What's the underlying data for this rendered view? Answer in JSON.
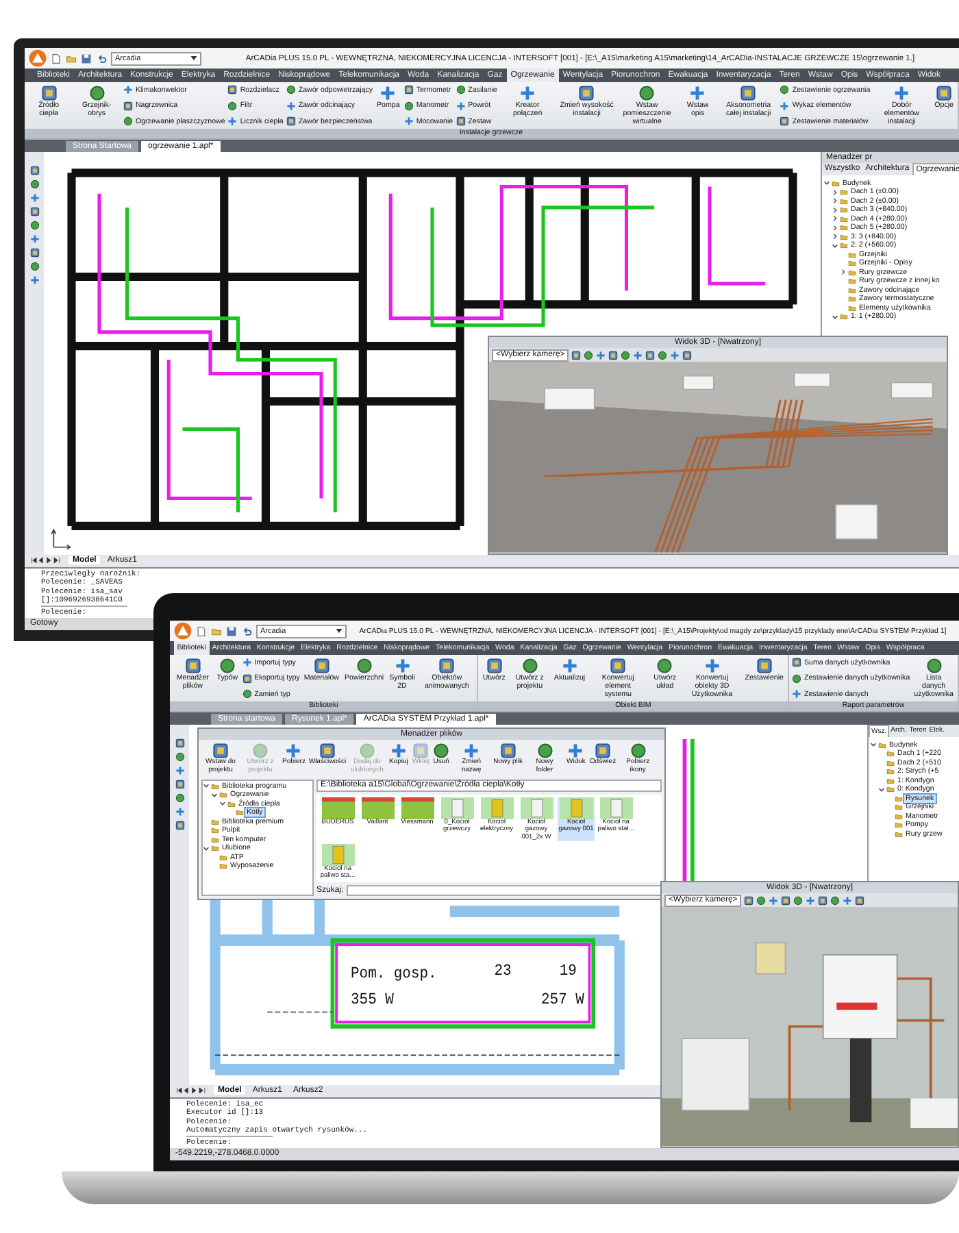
{
  "monitor": {
    "title": "ArCADia PLUS 15.0 PL - WEWNĘTRZNA, NIEKOMERCYJNA LICENCJA - INTERSOFT [001] - [E:\\_A15\\marketing A15\\marketing\\14_ArCADia-INSTALACJE GRZEWCZE 15\\ogrzewanie 1.]",
    "layer_dropdown": "Arcadia",
    "menu_tabs": [
      {
        "label": "Biblioteki",
        "selected": false
      },
      {
        "label": "Architektura",
        "selected": false
      },
      {
        "label": "Konstrukcje",
        "selected": false
      },
      {
        "label": "Elektryka",
        "selected": false
      },
      {
        "label": "Rozdzielnice",
        "selected": false
      },
      {
        "label": "Niskoprądowe",
        "selected": false
      },
      {
        "label": "Telekomunikacja",
        "selected": false
      },
      {
        "label": "Woda",
        "selected": false
      },
      {
        "label": "Kanalizacja",
        "selected": false
      },
      {
        "label": "Gaz",
        "selected": false
      },
      {
        "label": "Ogrzewanie",
        "selected": true
      },
      {
        "label": "Wentylacja",
        "selected": false
      },
      {
        "label": "Piorunochron",
        "selected": false
      },
      {
        "label": "Ewakuacja",
        "selected": false
      },
      {
        "label": "Inwentaryzacja",
        "selected": false
      },
      {
        "label": "Teren",
        "selected": false
      },
      {
        "label": "Wstaw",
        "selected": false
      },
      {
        "label": "Opis",
        "selected": false
      },
      {
        "label": "Współpraca",
        "selected": false
      },
      {
        "label": "Widok",
        "selected": false
      }
    ],
    "ribbon": [
      {
        "label": "Instalacje grzewcze",
        "columns": [
          {
            "kind": "large",
            "label": "Źródło ciepła"
          },
          {
            "kind": "large",
            "label": "Grzejnik-obrys"
          },
          {
            "kind": "stack",
            "items": [
              "Klimakonwektor",
              "Nagrzewnica",
              "Ogrzewanie płaszczyznowe"
            ]
          },
          {
            "kind": "stack",
            "items": [
              "Rozdzielacz",
              "Filtr",
              "Licznik ciepła"
            ]
          },
          {
            "kind": "stack",
            "items": [
              "Zawór odpowietrzający",
              "Zawór odcinający",
              "Zawór bezpieczeństwa"
            ]
          },
          {
            "kind": "large",
            "label": "Pompa"
          },
          {
            "kind": "stack",
            "items": [
              "Termometr",
              "Manometr",
              "Mocowanie"
            ]
          },
          {
            "kind": "stack",
            "items": [
              "Zasilanie",
              "Powrót",
              "Zestaw"
            ]
          },
          {
            "kind": "large",
            "label": "Kreator połączeń"
          },
          {
            "kind": "large",
            "label": "Zmień wysokość instalacji"
          },
          {
            "kind": "large",
            "label": "Wstaw pomieszczenie wirtualne"
          },
          {
            "kind": "large",
            "label": "Wstaw opis"
          },
          {
            "kind": "large",
            "label": "Aksonometria całej instalacji"
          },
          {
            "kind": "stack",
            "items": [
              "Zestawienie ogrzewania",
              "Wykaz elementów",
              "Zestawienie materiałów"
            ]
          },
          {
            "kind": "large",
            "label": "Dobór elementów instalacji"
          },
          {
            "kind": "large",
            "label": "Opcje"
          }
        ]
      }
    ],
    "doc_tabs": [
      {
        "label": "Strona Startowa",
        "selected": false
      },
      {
        "label": "ogrzewanie 1.apl*",
        "selected": true
      }
    ],
    "panel": {
      "title": "Menadżer pr",
      "tabs": [
        {
          "label": "Wszystko",
          "selected": false
        },
        {
          "label": "Architektura",
          "selected": false
        },
        {
          "label": "Ogrzewanie",
          "selected": true
        }
      ],
      "tree": [
        {
          "label": "Budynek",
          "expanded": true,
          "selected": false,
          "children": [
            {
              "label": "Dach 1 (±0.00)",
              "expanded": false,
              "selected": false
            },
            {
              "label": "Dach 2 (±0.00)",
              "expanded": false,
              "selected": false
            },
            {
              "label": "Dach 3 (+840.00)",
              "expanded": false,
              "selected": false
            },
            {
              "label": "Dach 4 (+280.00)",
              "expanded": false,
              "selected": false
            },
            {
              "label": "Dach 5 (+280.00)",
              "expanded": false,
              "selected": false
            },
            {
              "label": "3: 3 (+840.00)",
              "expanded": false,
              "selected": false
            },
            {
              "label": "2: 2 (+560.00)",
              "expanded": true,
              "selected": false,
              "children": [
                {
                  "label": "Grzejniki",
                  "selected": false
                },
                {
                  "label": "Grzejniki - Opisy",
                  "selected": false
                },
                {
                  "label": "Rury grzewcze",
                  "expanded": false,
                  "selected": false
                },
                {
                  "label": "Rury grzewcze z innej ko",
                  "selected": false
                },
                {
                  "label": "Zawory odcinające",
                  "selected": false
                },
                {
                  "label": "Zawory termostatyczne",
                  "selected": false
                },
                {
                  "label": "Elementy użytkownika",
                  "selected": false
                }
              ]
            },
            {
              "label": "1: 1 (+280.00)",
              "expanded": true,
              "selected": false
            }
          ]
        }
      ]
    },
    "view3d": {
      "title": "Widok 3D - [Nwatrzony]",
      "camera": "<Wybierz kamerę>"
    },
    "sheet_tabs": [
      {
        "label": "Model",
        "selected": true
      },
      {
        "label": "Arkusz1",
        "selected": false
      }
    ],
    "command": {
      "history": [
        "Przeciwległy narożnik:",
        "Polecenie: _SAVEAS",
        "Polecenie: isa_sav",
        "[]:1096926938641C0"
      ],
      "prompt": "Polecenie:"
    },
    "status": "Gotowy"
  },
  "laptop": {
    "title": "ArCADia PLUS 15.0 PL - WEWNĘTRZNA, NIEKOMERCYJNA LICENCJA - INTERSOFT [001] - [E:\\_A15\\Projekty\\od magdy ze\\przyklady\\15 przyklady ene\\ArCADia SYSTEM Przykład 1]",
    "layer_dropdown": "Arcadia",
    "menu_tabs": [
      {
        "label": "Biblioteki",
        "selected": true
      },
      {
        "label": "Architektura",
        "selected": false
      },
      {
        "label": "Konstrukcje",
        "selected": false
      },
      {
        "label": "Elektryka",
        "selected": false
      },
      {
        "label": "Rozdzielnice",
        "selected": false
      },
      {
        "label": "Niskoprądowe",
        "selected": false
      },
      {
        "label": "Telekomunikacja",
        "selected": false
      },
      {
        "label": "Woda",
        "selected": false
      },
      {
        "label": "Kanalizacja",
        "selected": false
      },
      {
        "label": "Gaz",
        "selected": false
      },
      {
        "label": "Ogrzewanie",
        "selected": false
      },
      {
        "label": "Wentylacja",
        "selected": false
      },
      {
        "label": "Piorunochron",
        "selected": false
      },
      {
        "label": "Ewakuacja",
        "selected": false
      },
      {
        "label": "Inwentaryzacja",
        "selected": false
      },
      {
        "label": "Teren",
        "selected": false
      },
      {
        "label": "Wstaw",
        "selected": false
      },
      {
        "label": "Opis",
        "selected": false
      },
      {
        "label": "Współpraca",
        "selected": false
      }
    ],
    "ribbon": [
      {
        "label": "Biblioteki",
        "columns": [
          {
            "kind": "large",
            "label": "Menadżer plików"
          },
          {
            "kind": "large",
            "label": "Typów"
          },
          {
            "kind": "stack",
            "items": [
              "Importuj typy",
              "Eksportuj typy",
              "Zamień typ"
            ]
          },
          {
            "kind": "large",
            "label": "Materiałów"
          },
          {
            "kind": "large",
            "label": "Powierzchni"
          },
          {
            "kind": "large",
            "label": "Symboli 2D"
          },
          {
            "kind": "large",
            "label": "Obiektów animowanych"
          }
        ]
      },
      {
        "label": "Obiekt BIM",
        "columns": [
          {
            "kind": "large",
            "label": "Utwórz"
          },
          {
            "kind": "large",
            "label": "Utwórz z projektu"
          },
          {
            "kind": "large",
            "label": "Aktualizuj"
          },
          {
            "kind": "large",
            "label": "Konwertuj element systemu"
          },
          {
            "kind": "large",
            "label": "Utwórz układ"
          },
          {
            "kind": "large",
            "label": "Konwertuj obiekty 3D Użytkownika"
          },
          {
            "kind": "large",
            "label": "Zestawienie"
          }
        ]
      },
      {
        "label": "Raport parametrów",
        "columns": [
          {
            "kind": "stack",
            "items": [
              "Suma danych użytkownika",
              "Zestawienie danych użytkownika",
              "Zestawienie danych"
            ]
          },
          {
            "kind": "large",
            "label": "Lista danych użytkownika"
          }
        ]
      }
    ],
    "doc_tabs": [
      {
        "label": "Strona startowa",
        "selected": false
      },
      {
        "label": "Rysunek 1.apl*",
        "selected": false
      },
      {
        "label": "ArCADia SYSTEM Przykład 1.apl*",
        "selected": true
      }
    ],
    "file_manager": {
      "title": "Menadżer plików",
      "toolbar": [
        {
          "label": "Wstaw do projektu",
          "disabled": false
        },
        {
          "label": "Utwórz z projektu",
          "disabled": true
        },
        {
          "label": "Pobierz",
          "disabled": false
        },
        {
          "label": "Właściwości",
          "disabled": false
        },
        {
          "label": "Dodaj do ulubionych",
          "disabled": true
        },
        {
          "label": "Kopiuj",
          "disabled": false
        },
        {
          "label": "Wklej",
          "disabled": true
        },
        {
          "label": "Usuń",
          "disabled": false
        },
        {
          "label": "Zmień nazwę",
          "disabled": false
        },
        {
          "label": "Nowy plik",
          "disabled": false
        },
        {
          "label": "Nowy folder",
          "disabled": false
        },
        {
          "label": "Widok",
          "disabled": false
        },
        {
          "label": "Odśwież",
          "disabled": false
        },
        {
          "label": "Pobierz ikony",
          "disabled": false
        }
      ],
      "path": "E:\\Biblioteka a15\\Global\\Ogrzewanie\\Źródła ciepła\\Kotły",
      "tree": [
        {
          "label": "Biblioteka programu",
          "expanded": true,
          "selected": false,
          "children": [
            {
              "label": "Ogrzewanie",
              "expanded": true,
              "selected": false,
              "children": [
                {
                  "label": "Źródła ciepła",
                  "expanded": true,
                  "selected": false,
                  "children": [
                    {
                      "label": "Kotły",
                      "selected": true
                    }
                  ]
                }
              ]
            }
          ]
        },
        {
          "label": "Biblioteka premium",
          "selected": false
        },
        {
          "label": "Pulpit",
          "selected": false
        },
        {
          "label": "Ten komputer",
          "selected": false
        },
        {
          "label": "Ulubione",
          "expanded": true,
          "selected": false,
          "children": [
            {
              "label": "ATP",
              "selected": false
            },
            {
              "label": "Wyposażenie",
              "selected": false
            }
          ]
        }
      ],
      "files": [
        {
          "kind": "folder",
          "label": "BUDERUS",
          "selected": false
        },
        {
          "kind": "folder",
          "label": "Vaillant",
          "selected": false
        },
        {
          "kind": "folder",
          "label": "Viessmann",
          "selected": false
        },
        {
          "kind": "boiler",
          "label": "0_Kocioł grzewczy",
          "selected": false
        },
        {
          "kind": "boiler",
          "label": "Kocioł elektryczny",
          "selected": false
        },
        {
          "kind": "boiler",
          "label": "Kocioł gazowy 001_2x W",
          "selected": false
        },
        {
          "kind": "boiler",
          "label": "Kocioł gazowy 001",
          "selected": true
        },
        {
          "kind": "boiler",
          "label": "Kocioł na paliwo stał...",
          "selected": false
        },
        {
          "kind": "boiler",
          "label": "Kocioł na paliwo sta...",
          "selected": false
        }
      ],
      "search_label": "Szukaj:"
    },
    "plan_labels": [
      "Pom. gosp.",
      "23",
      "19",
      "355 W",
      "257 W"
    ],
    "panel": {
      "tabs": [
        {
          "label": "Wsz.",
          "selected": true
        },
        {
          "label": "Arch.",
          "selected": false
        },
        {
          "label": "Teren",
          "selected": false
        },
        {
          "label": "Elek.",
          "selected": false
        }
      ],
      "tree": [
        {
          "label": "Budynek",
          "expanded": true,
          "selected": false,
          "children": [
            {
              "label": "Dach 1 (+220",
              "selected": false
            },
            {
              "label": "Dach 2 (+510",
              "selected": false
            },
            {
              "label": "2: Strych (+5",
              "selected": false
            },
            {
              "label": "1: Kondygn",
              "selected": false
            },
            {
              "label": "0: Kondygn",
              "expanded": true,
              "selected": false,
              "children": [
                {
                  "label": "Rysunek",
                  "selected": true
                },
                {
                  "label": "Grzejniki",
                  "selected": false
                },
                {
                  "label": "Manometr",
                  "selected": false
                },
                {
                  "label": "Pompy",
                  "selected": false
                },
                {
                  "label": "Rury grzew",
                  "selected": false
                }
              ]
            }
          ]
        }
      ]
    },
    "view3d": {
      "title": "Widok 3D - [Nwatrzony]",
      "camera": "<Wybierz kamerę>"
    },
    "sheet_tabs": [
      {
        "label": "Model",
        "selected": true
      },
      {
        "label": "Arkusz1",
        "selected": false
      },
      {
        "label": "Arkusz2",
        "selected": false
      }
    ],
    "command": {
      "history": [
        "Polecenie: isa_ec",
        "Executor id []:13",
        "Polecenie:",
        "Automatyczny zapis otwartych rysunków..."
      ],
      "prompt": "Polecenie:"
    },
    "status": "-549.2219,-278.0468,0.0000"
  }
}
